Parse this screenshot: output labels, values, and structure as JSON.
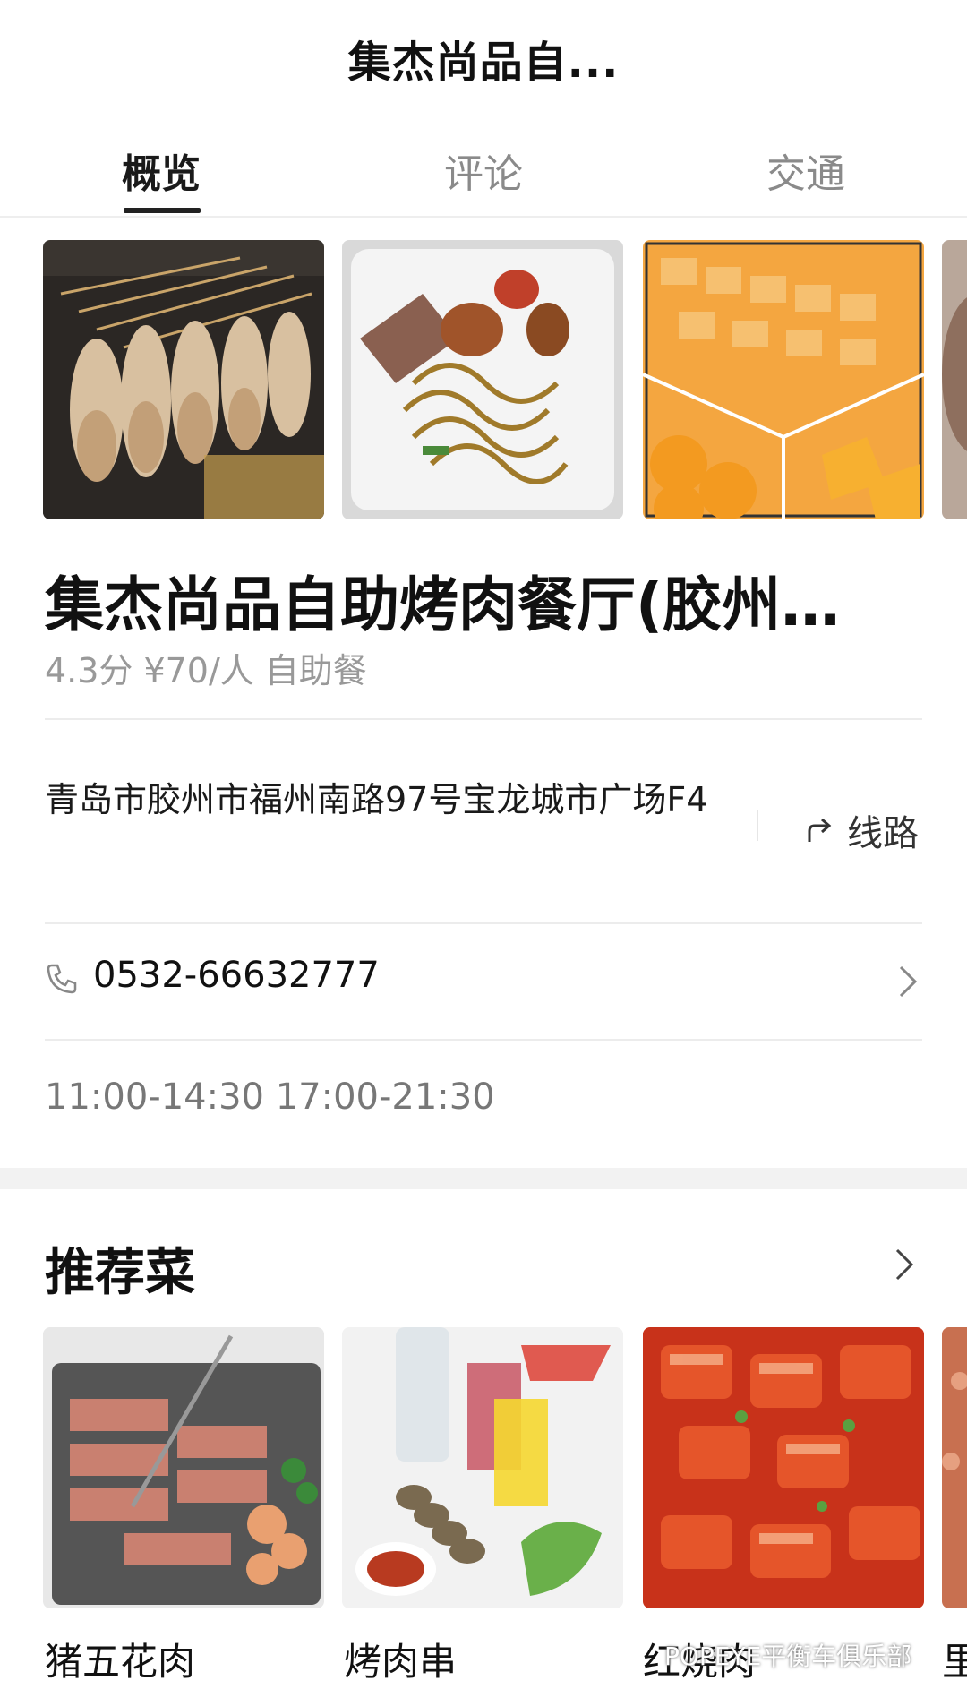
{
  "header": {
    "title": "集杰尚品自..."
  },
  "tabs": [
    {
      "label": "概览",
      "active": true
    },
    {
      "label": "评论",
      "active": false
    },
    {
      "label": "交通",
      "active": false
    }
  ],
  "gallery": {
    "photos": [
      {
        "name": "grilled-squid-photo"
      },
      {
        "name": "noodles-plate-photo"
      },
      {
        "name": "orange-dessert-photo"
      },
      {
        "name": "partial-photo"
      }
    ]
  },
  "restaurant": {
    "name": "集杰尚品自助烤肉餐厅(胶州…",
    "rating": "4.3分",
    "price": "¥70/人",
    "category": "自助餐",
    "address": "青岛市胶州市福州南路97号宝龙城市广场F4",
    "route_label": "线路",
    "phone": "0532-66632777",
    "hours": "11:00-14:30 17:00-21:30"
  },
  "recommended": {
    "title": "推荐菜",
    "dishes": [
      {
        "label": "猪五花肉"
      },
      {
        "label": "烤肉串"
      },
      {
        "label": "红烧肉"
      },
      {
        "label": "里"
      }
    ]
  },
  "watermark": "POPEYE平衡车俱乐部",
  "icons": [
    "route-arrow-icon",
    "phone-icon",
    "chevron-right-icon"
  ],
  "colors": {
    "text": "#111111",
    "muted": "#999999",
    "divider": "#ececec",
    "underline": "#222222"
  }
}
